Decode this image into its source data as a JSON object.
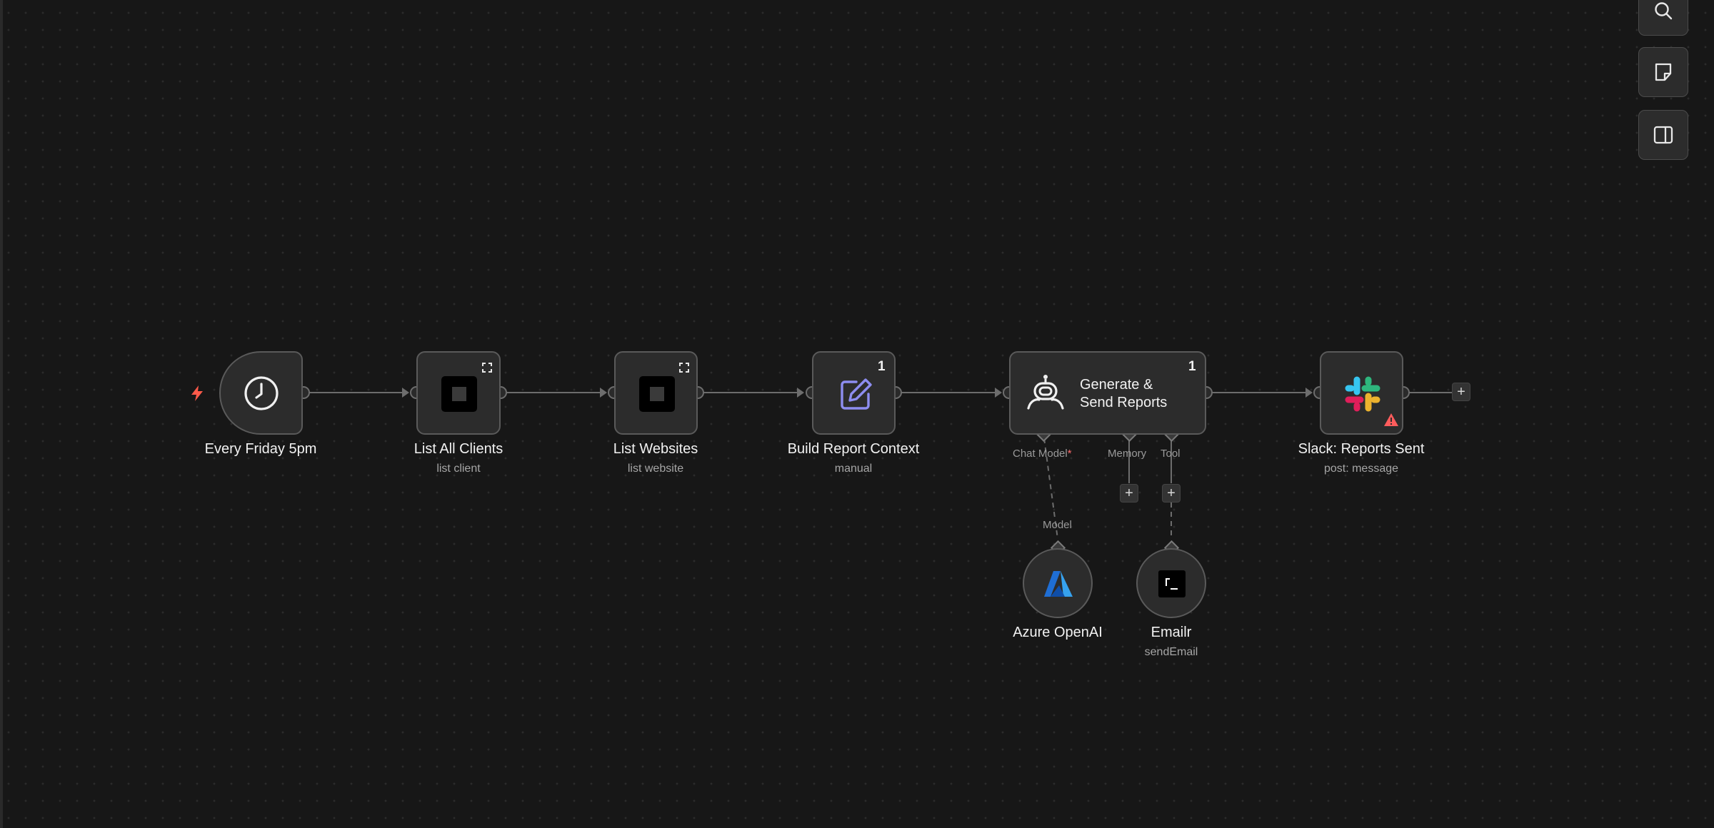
{
  "canvas": {
    "nodes": {
      "trigger": {
        "title": "Every Friday 5pm",
        "icon": "clock-icon"
      },
      "list_clients": {
        "title": "List All Clients",
        "subtitle": "list client",
        "icon": "square-app-icon"
      },
      "list_websites": {
        "title": "List Websites",
        "subtitle": "list website",
        "icon": "square-app-icon"
      },
      "build_context": {
        "title": "Build Report Context",
        "subtitle": "manual",
        "badge": "1",
        "icon": "pencil-square-icon"
      },
      "agent": {
        "title_line1": "Generate &",
        "title_line2": "Send Reports",
        "badge": "1",
        "icon": "robot-icon"
      },
      "slack": {
        "title": "Slack: Reports Sent",
        "subtitle": "post: message",
        "icon": "slack-icon",
        "warning_icon": "warning-icon"
      },
      "azure": {
        "title": "Azure OpenAI",
        "icon": "azure-icon"
      },
      "emailr": {
        "title": "Emailr",
        "subtitle": "sendEmail",
        "icon": "terminal-icon"
      }
    },
    "agent_ports": {
      "chat_model": "Chat Model",
      "required_mark": "*",
      "memory": "Memory",
      "tool": "Tool"
    },
    "model_connector_label": "Model",
    "add_symbol": "+"
  },
  "toolbar": [
    "search-icon",
    "sticky-note-icon",
    "side-panel-icon"
  ],
  "colors": {
    "background": "#171717",
    "node_fill": "#2c2c2c",
    "node_border": "#5a5a5a",
    "trigger_bolt": "#ff5a4a",
    "required_mark": "#ff6b6b",
    "edit_icon": "#8d8df0",
    "warning": "#ff5c5c"
  }
}
